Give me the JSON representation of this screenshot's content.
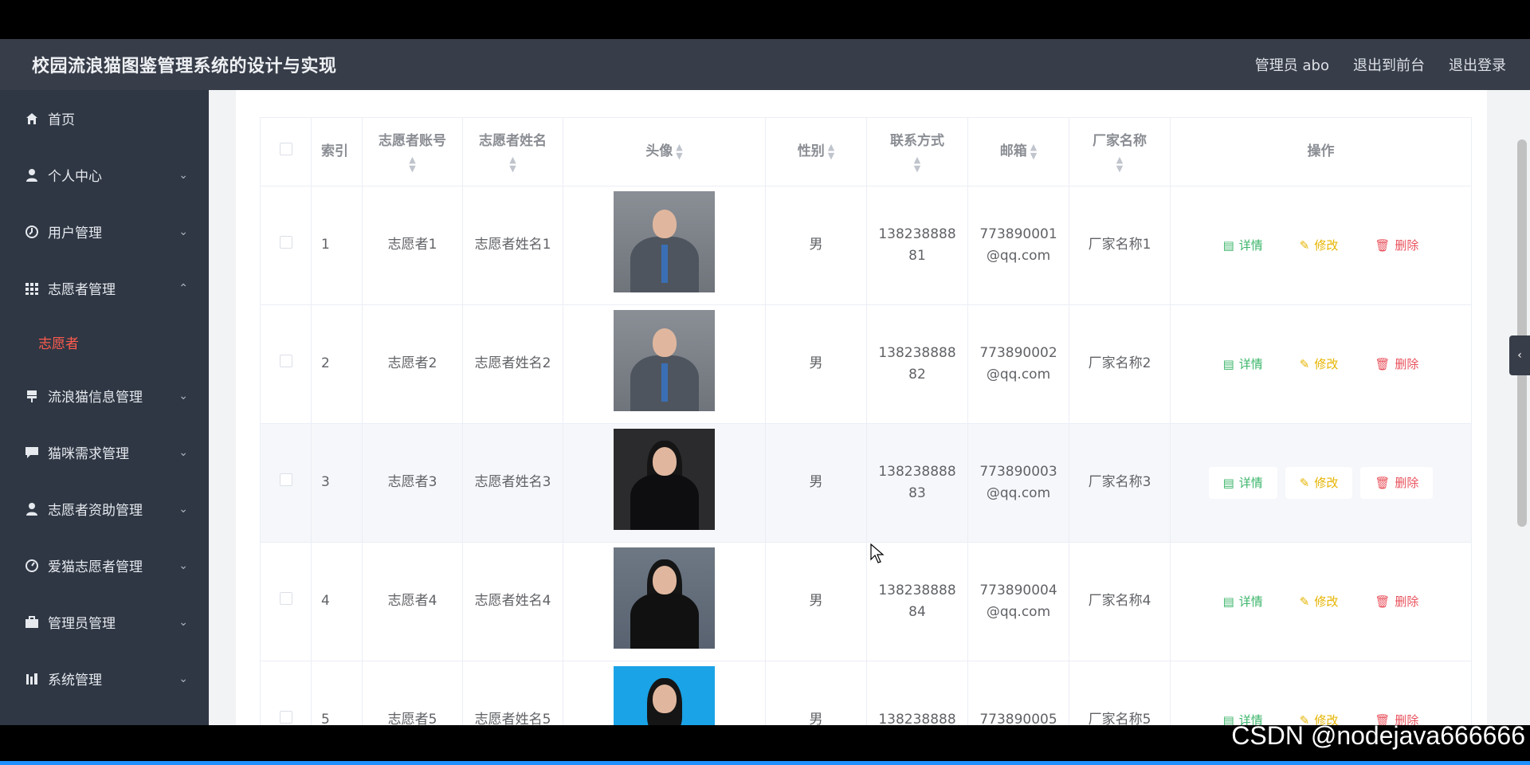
{
  "header": {
    "title": "校园流浪猫图鉴管理系统的设计与实现",
    "admin_label": "管理员 abo",
    "to_front": "退出到前台",
    "logout": "退出登录"
  },
  "sidebar": {
    "items": [
      {
        "label": "首页",
        "icon": "home-icon"
      },
      {
        "label": "个人中心",
        "icon": "user-icon"
      },
      {
        "label": "用户管理",
        "icon": "clock-icon"
      },
      {
        "label": "志愿者管理",
        "icon": "grid-icon"
      },
      {
        "label": "志愿者",
        "icon": ""
      },
      {
        "label": "流浪猫信息管理",
        "icon": "flag-icon"
      },
      {
        "label": "猫咪需求管理",
        "icon": "chat-icon"
      },
      {
        "label": "志愿者资助管理",
        "icon": "user-icon"
      },
      {
        "label": "爱猫志愿者管理",
        "icon": "gauge-icon"
      },
      {
        "label": "管理员管理",
        "icon": "briefcase-icon"
      },
      {
        "label": "系统管理",
        "icon": "chart-icon"
      }
    ]
  },
  "table": {
    "headers": [
      "索引",
      "志愿者账号",
      "志愿者姓名",
      "头像",
      "性别",
      "联系方式",
      "邮箱",
      "厂家名称",
      "操作"
    ],
    "rows": [
      {
        "index": "1",
        "account": "志愿者1",
        "name": "志愿者姓名1",
        "gender": "男",
        "phone": "138238888\n81",
        "email": "773890001\n@qq.com",
        "vendor": "厂家名称1"
      },
      {
        "index": "2",
        "account": "志愿者2",
        "name": "志愿者姓名2",
        "gender": "男",
        "phone": "138238888\n82",
        "email": "773890002\n@qq.com",
        "vendor": "厂家名称2"
      },
      {
        "index": "3",
        "account": "志愿者3",
        "name": "志愿者姓名3",
        "gender": "男",
        "phone": "138238888\n83",
        "email": "773890003\n@qq.com",
        "vendor": "厂家名称3"
      },
      {
        "index": "4",
        "account": "志愿者4",
        "name": "志愿者姓名4",
        "gender": "男",
        "phone": "138238888\n84",
        "email": "773890004\n@qq.com",
        "vendor": "厂家名称4"
      },
      {
        "index": "5",
        "account": "志愿者5",
        "name": "志愿者姓名5",
        "gender": "男",
        "phone": "138238888",
        "email": "773890005",
        "vendor": "厂家名称5"
      }
    ],
    "actions": {
      "detail": "详情",
      "edit": "修改",
      "delete": "删除"
    }
  },
  "watermark": "CSDN @nodejava666666",
  "colors": {
    "header_bg": "#373d49",
    "sidebar_bg": "#2f3744",
    "active": "#ff5b4d",
    "detail": "#3bb56a",
    "edit": "#e6b400",
    "delete": "#e8515c"
  }
}
